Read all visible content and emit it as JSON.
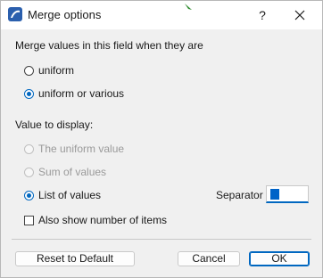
{
  "window": {
    "title": "Merge options",
    "help_label": "?",
    "icons": {
      "app": "archicad-app-icon",
      "close": "close-icon"
    }
  },
  "merge_section": {
    "label": "Merge values in this field when they are",
    "options": [
      {
        "label": "uniform",
        "checked": false
      },
      {
        "label": "uniform or various",
        "checked": true
      }
    ]
  },
  "display_section": {
    "label": "Value to display:",
    "options": [
      {
        "label": "The uniform value",
        "checked": false,
        "disabled": true
      },
      {
        "label": "Sum of values",
        "checked": false,
        "disabled": true
      },
      {
        "label": "List of values",
        "checked": true,
        "disabled": false
      }
    ],
    "separator_label": "Separator",
    "separator_value": ",",
    "show_count_label": "Also show number of items",
    "show_count_checked": false
  },
  "buttons": {
    "reset": "Reset to Default",
    "cancel": "Cancel",
    "ok": "OK"
  },
  "colors": {
    "accent": "#0067c0",
    "disabled_text": "#9a9a9a"
  }
}
